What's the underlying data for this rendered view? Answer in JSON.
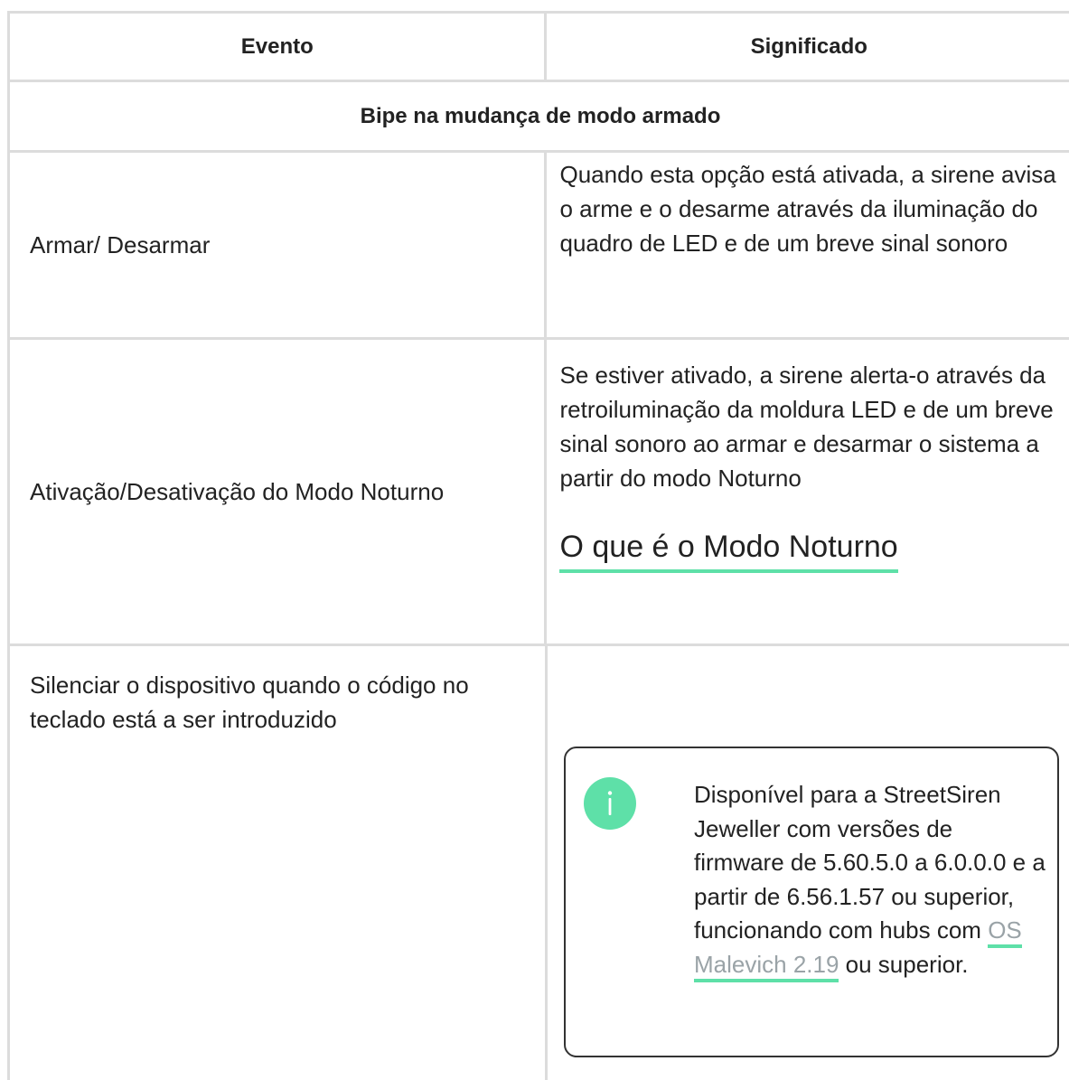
{
  "table": {
    "headers": [
      "Evento",
      "Significado"
    ],
    "section_title": "Bipe na mudança de modo armado",
    "rows": [
      {
        "event": "Armar/ Desarmar",
        "meaning": "Quando esta opção está ativada, a sirene avisa o arme e o desarme através da iluminação do quadro de LED e de um breve sinal sonoro"
      },
      {
        "event": "Ativação/Desativação do Modo Noturno",
        "meaning": "Se estiver ativado, a sirene alerta-o através da retroiluminação da moldura LED e de um breve sinal sonoro ao armar e desarmar o sistema a partir do modo Noturno",
        "link": "O que é o Modo Noturno"
      },
      {
        "event": "Silenciar o dispositivo quando o código no teclado está a ser introduzido",
        "meaning": ""
      }
    ]
  },
  "info_box": {
    "icon": "info-icon",
    "text_before_link": "Disponível para a StreetSiren Jeweller com versões de firmware de 5.60.5.0 a 6.0.0.0 e a partir de 6.56.1.57 ou superior, funcionando com hubs com ",
    "link_text": "OS Malevich 2.19",
    "text_after_link": " ou superior."
  },
  "colors": {
    "border": "#dcdcdc",
    "accent": "#5ee0a8",
    "link_gray": "#9aa3a7",
    "text": "#222222"
  }
}
